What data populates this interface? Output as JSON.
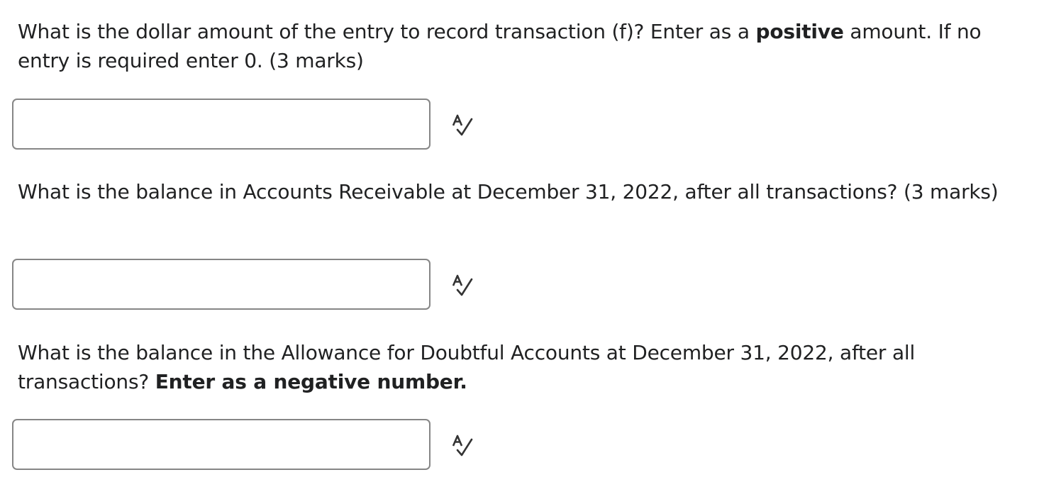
{
  "questions": [
    {
      "prompt_before": "What is the dollar amount of the entry to record transaction (f)? Enter as a ",
      "prompt_bold": "positive",
      "prompt_after": " amount. If no entry is required enter 0. (3 marks)",
      "input_value": ""
    },
    {
      "prompt_before": "What is the balance in Accounts Receivable at December 31, 2022, after all transactions? (3 marks)",
      "prompt_bold": "",
      "prompt_after": "",
      "input_value": ""
    },
    {
      "prompt_before": "What is the balance in the Allowance for Doubtful Accounts at December 31, 2022, after all transactions? ",
      "prompt_bold": "Enter as a negative number.",
      "prompt_after": "",
      "input_value": ""
    }
  ],
  "icons": {
    "spellcheck": "spellcheck-icon"
  },
  "colors": {
    "text": "#202122",
    "input_border": "#868686"
  }
}
